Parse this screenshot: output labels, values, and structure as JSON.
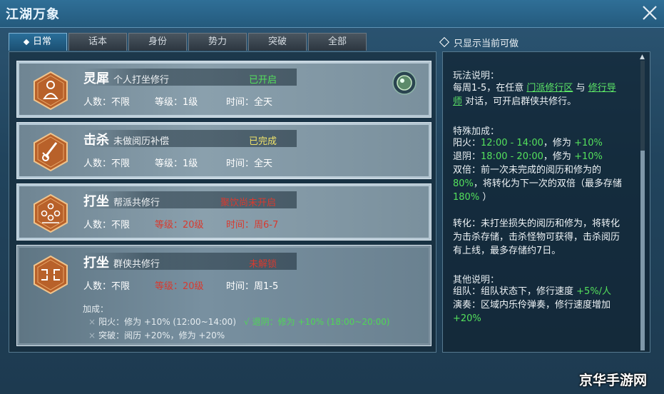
{
  "window": {
    "title": "江湖万象"
  },
  "tabs": [
    {
      "label": "日常"
    },
    {
      "label": "话本"
    },
    {
      "label": "身份"
    },
    {
      "label": "势力"
    },
    {
      "label": "突破"
    },
    {
      "label": "全部"
    }
  ],
  "filter": {
    "label": "只显示当前可做"
  },
  "cards": [
    {
      "name": "灵犀",
      "subtitle": "个人打坐修行",
      "status": "已开启",
      "status_color": "#54e05c",
      "players": "人数：不限",
      "level": "等级：1级",
      "time": "时间：全天",
      "icon": "meditation-icon"
    },
    {
      "name": "击杀",
      "subtitle": "未做阅历补偿",
      "status": "已完成",
      "status_color": "#f1e46a",
      "players": "人数：不限",
      "level": "等级：1级",
      "time": "时间：全天",
      "icon": "sword-icon"
    },
    {
      "name": "打坐",
      "subtitle": "帮派共修行",
      "status": "聚饮尚未开启",
      "status_color": "#d83a2f",
      "players": "人数：不限",
      "level": "等级：20级",
      "time": "时间：周6-7",
      "icon": "group-meditation-icon"
    },
    {
      "name": "打坐",
      "subtitle": "群侠共修行",
      "status": "未解锁",
      "status_color": "#d83a2f",
      "players": "人数：不限",
      "level": "等级：20级",
      "time": "时间：周1-5",
      "icon": "team-meditation-icon",
      "bonus_title": "加成：",
      "bonus_1a": "阳火：修为 +10% (12:00~14:00)",
      "bonus_1b": "退阴：修为 +10% (18:00~20:00)",
      "bonus_2": "突破：阅历 +20%，修为 +20%"
    }
  ],
  "right": {
    "s1_title": "玩法说明：",
    "s1_pre": "每周1-5，在任意",
    "s1_link1": "门派修行区",
    "s1_mid": "与",
    "s1_link2": "修行导师",
    "s1_post": "对话，可开启群侠共修行。",
    "s2_title": "特殊加成：",
    "s2_l1a": "阳火：",
    "s2_l1b": "12:00 - 14:00",
    "s2_l1c": "，修为",
    "s2_l1d": "+10%",
    "s2_l2a": "退阴：",
    "s2_l2b": "18:00 - 20:00",
    "s2_l2c": "，修为",
    "s2_l2d": "+10%",
    "s2_l3a": "双倍：前一次未完成的阅历和修为的",
    "s2_l3b": "80%",
    "s2_l3c": "，将转化为下一次的双倍（最多存储",
    "s2_l3d": "180%",
    "s2_l3e": "）",
    "s3": "转化：未打坐损失的阅历和修为，将转化为击杀存储，击杀怪物可获得，击杀阅历有上线，最多存储约7日。",
    "s4_title": "其他说明：",
    "s4_l1a": "组队：组队状态下，修行速度",
    "s4_l1b": "+5%/人",
    "s4_l2a": "演奏：区域内乐伶弹奏，修行速度增加",
    "s4_l2b": "+20%"
  },
  "watermark": "京华手游网"
}
